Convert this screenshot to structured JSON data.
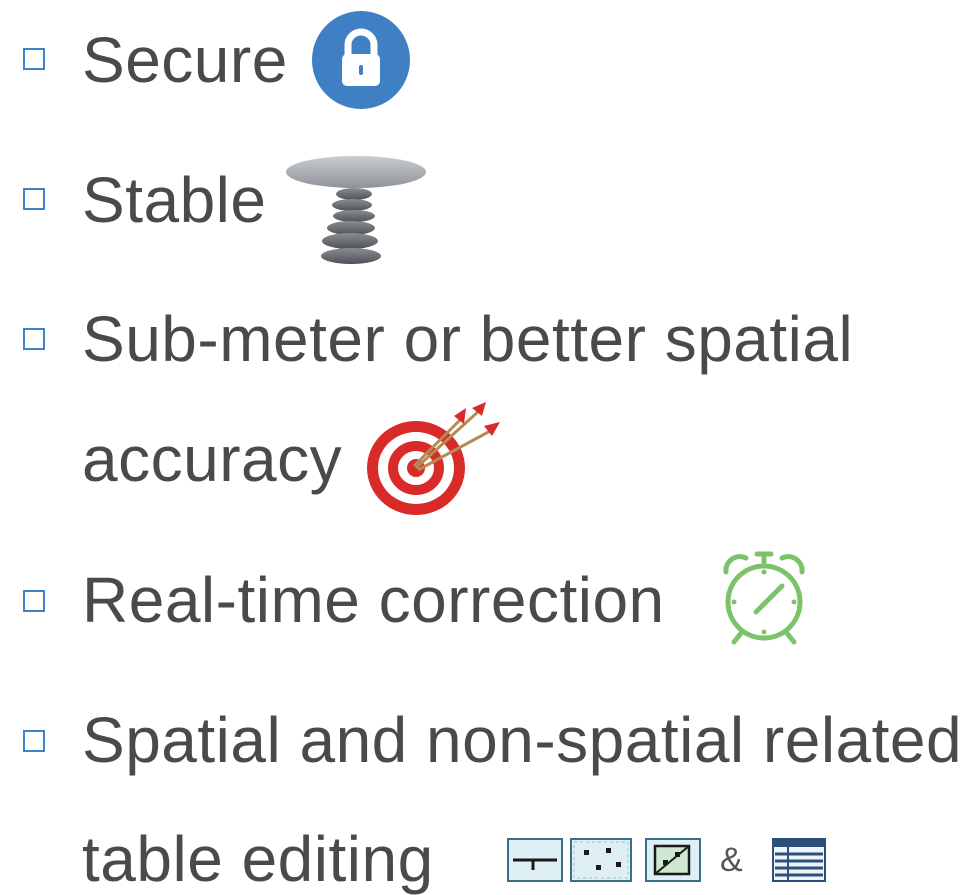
{
  "items": [
    {
      "label": "Secure",
      "icon": "lock-icon"
    },
    {
      "label": "Stable",
      "icon": "balanced-stones-icon"
    },
    {
      "label": "Sub-meter or better spatial",
      "continuation": "accuracy",
      "icon": "target-icon"
    },
    {
      "label": "Real-time correction",
      "icon": "alarm-clock-icon"
    },
    {
      "label": "Spatial and non-spatial related",
      "continuation": "table editing",
      "icons": [
        "line-layer-icon",
        "point-layer-icon",
        "polygon-layer-icon",
        "table-icon"
      ],
      "connector": "&"
    }
  ],
  "colors": {
    "bullet": "#3d83c5",
    "text": "#4a4a4a",
    "lock_bg": "#3f7fc4",
    "target_red": "#d92a2a",
    "clock_green": "#7cc26a"
  }
}
